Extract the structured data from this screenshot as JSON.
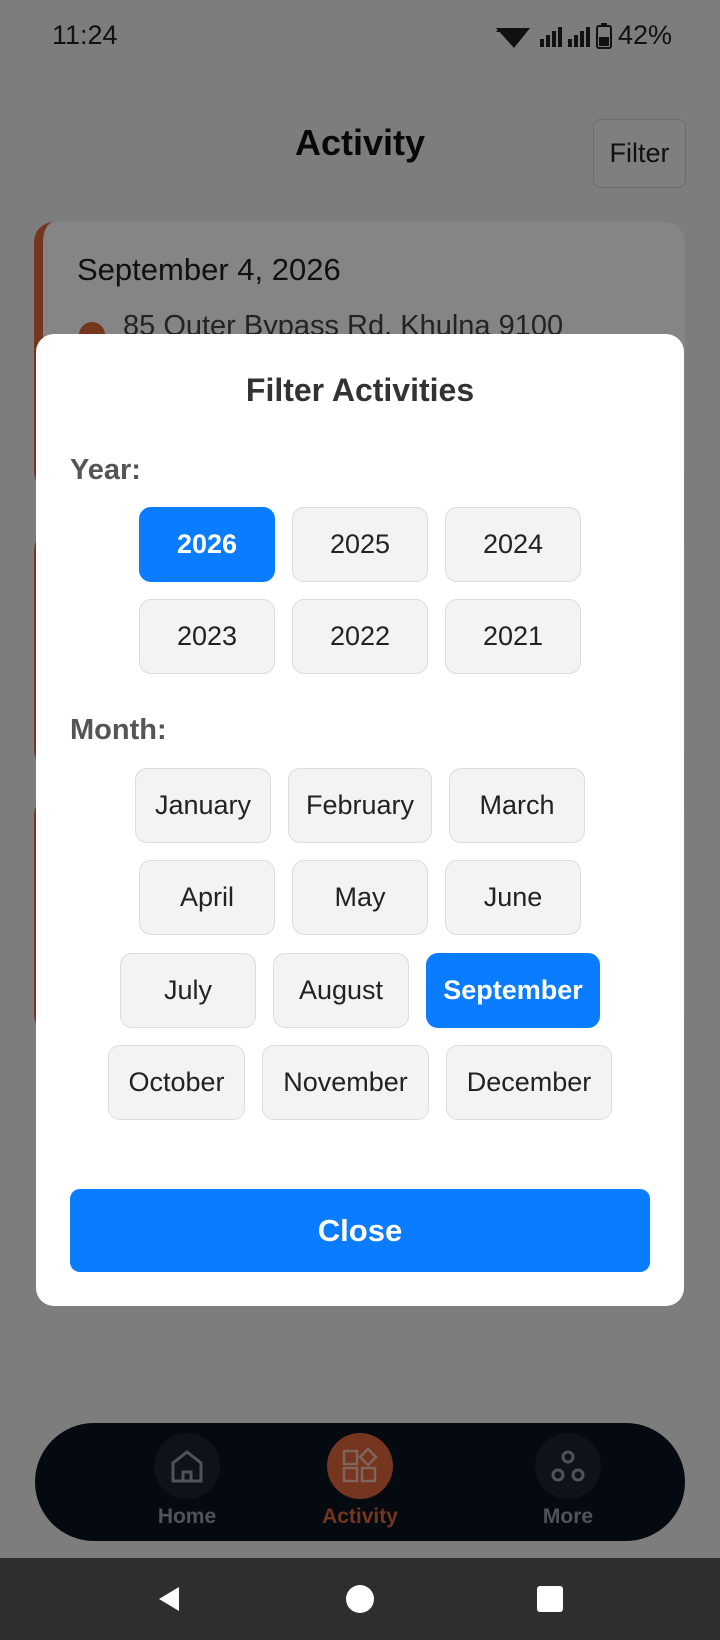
{
  "status_bar": {
    "time": "11:24",
    "battery": "42%"
  },
  "header": {
    "title": "Activity",
    "filter_label": "Filter"
  },
  "activity_card": {
    "date": "September 4, 2026",
    "address": "85 Outer Bypass Rd, Khulna 9100"
  },
  "modal": {
    "title": "Filter Activities",
    "year_label": "Year:",
    "years": [
      "2026",
      "2025",
      "2024",
      "2023",
      "2022",
      "2021"
    ],
    "selected_year": "2026",
    "month_label": "Month:",
    "months": [
      "January",
      "February",
      "March",
      "April",
      "May",
      "June",
      "July",
      "August",
      "September",
      "October",
      "November",
      "December"
    ],
    "selected_month": "September",
    "close_label": "Close"
  },
  "bottom_nav": {
    "items": [
      {
        "label": "Home",
        "icon": "home-icon"
      },
      {
        "label": "Activity",
        "icon": "activity-icon",
        "active": true
      },
      {
        "label": "More",
        "icon": "more-icon"
      }
    ]
  },
  "colors": {
    "accent": "#0a7cff",
    "brand": "#e0663a",
    "nav_bg": "#0b1220"
  }
}
